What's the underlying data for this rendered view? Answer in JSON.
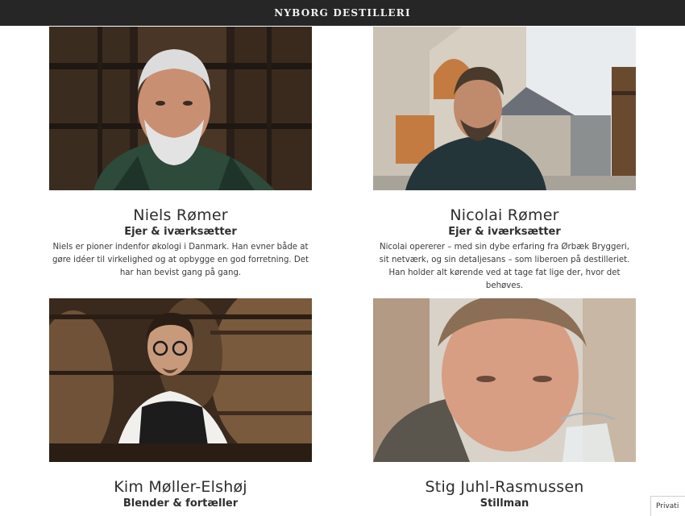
{
  "header": {
    "brand": "NYBORG DESTILLERI"
  },
  "team": [
    {
      "name": "Niels Rømer",
      "role": "Ejer & iværksætter",
      "bio": "Niels er pioner indenfor økologi i Danmark. Han evner både at gøre idéer til virkelighed og at opbygge en god forretning. Det har han bevist gang på gang."
    },
    {
      "name": "Nicolai Rømer",
      "role": "Ejer & iværksætter",
      "bio": "Nicolai opererer – med sin dybe erfaring fra Ørbæk Bryggeri, sit netværk, og sin detaljesans – som liberoen på destilleriet. Han holder alt kørende ved at tage fat lige der, hvor det behøves."
    },
    {
      "name": "Kim Møller-Elshøj",
      "role": "Blender & fortæller"
    },
    {
      "name": "Stig Juhl-Rasmussen",
      "role": "Stillman"
    }
  ],
  "privacy_label": "Privati",
  "colors": {
    "topbar": "#262626",
    "text": "#2e2e2e"
  }
}
